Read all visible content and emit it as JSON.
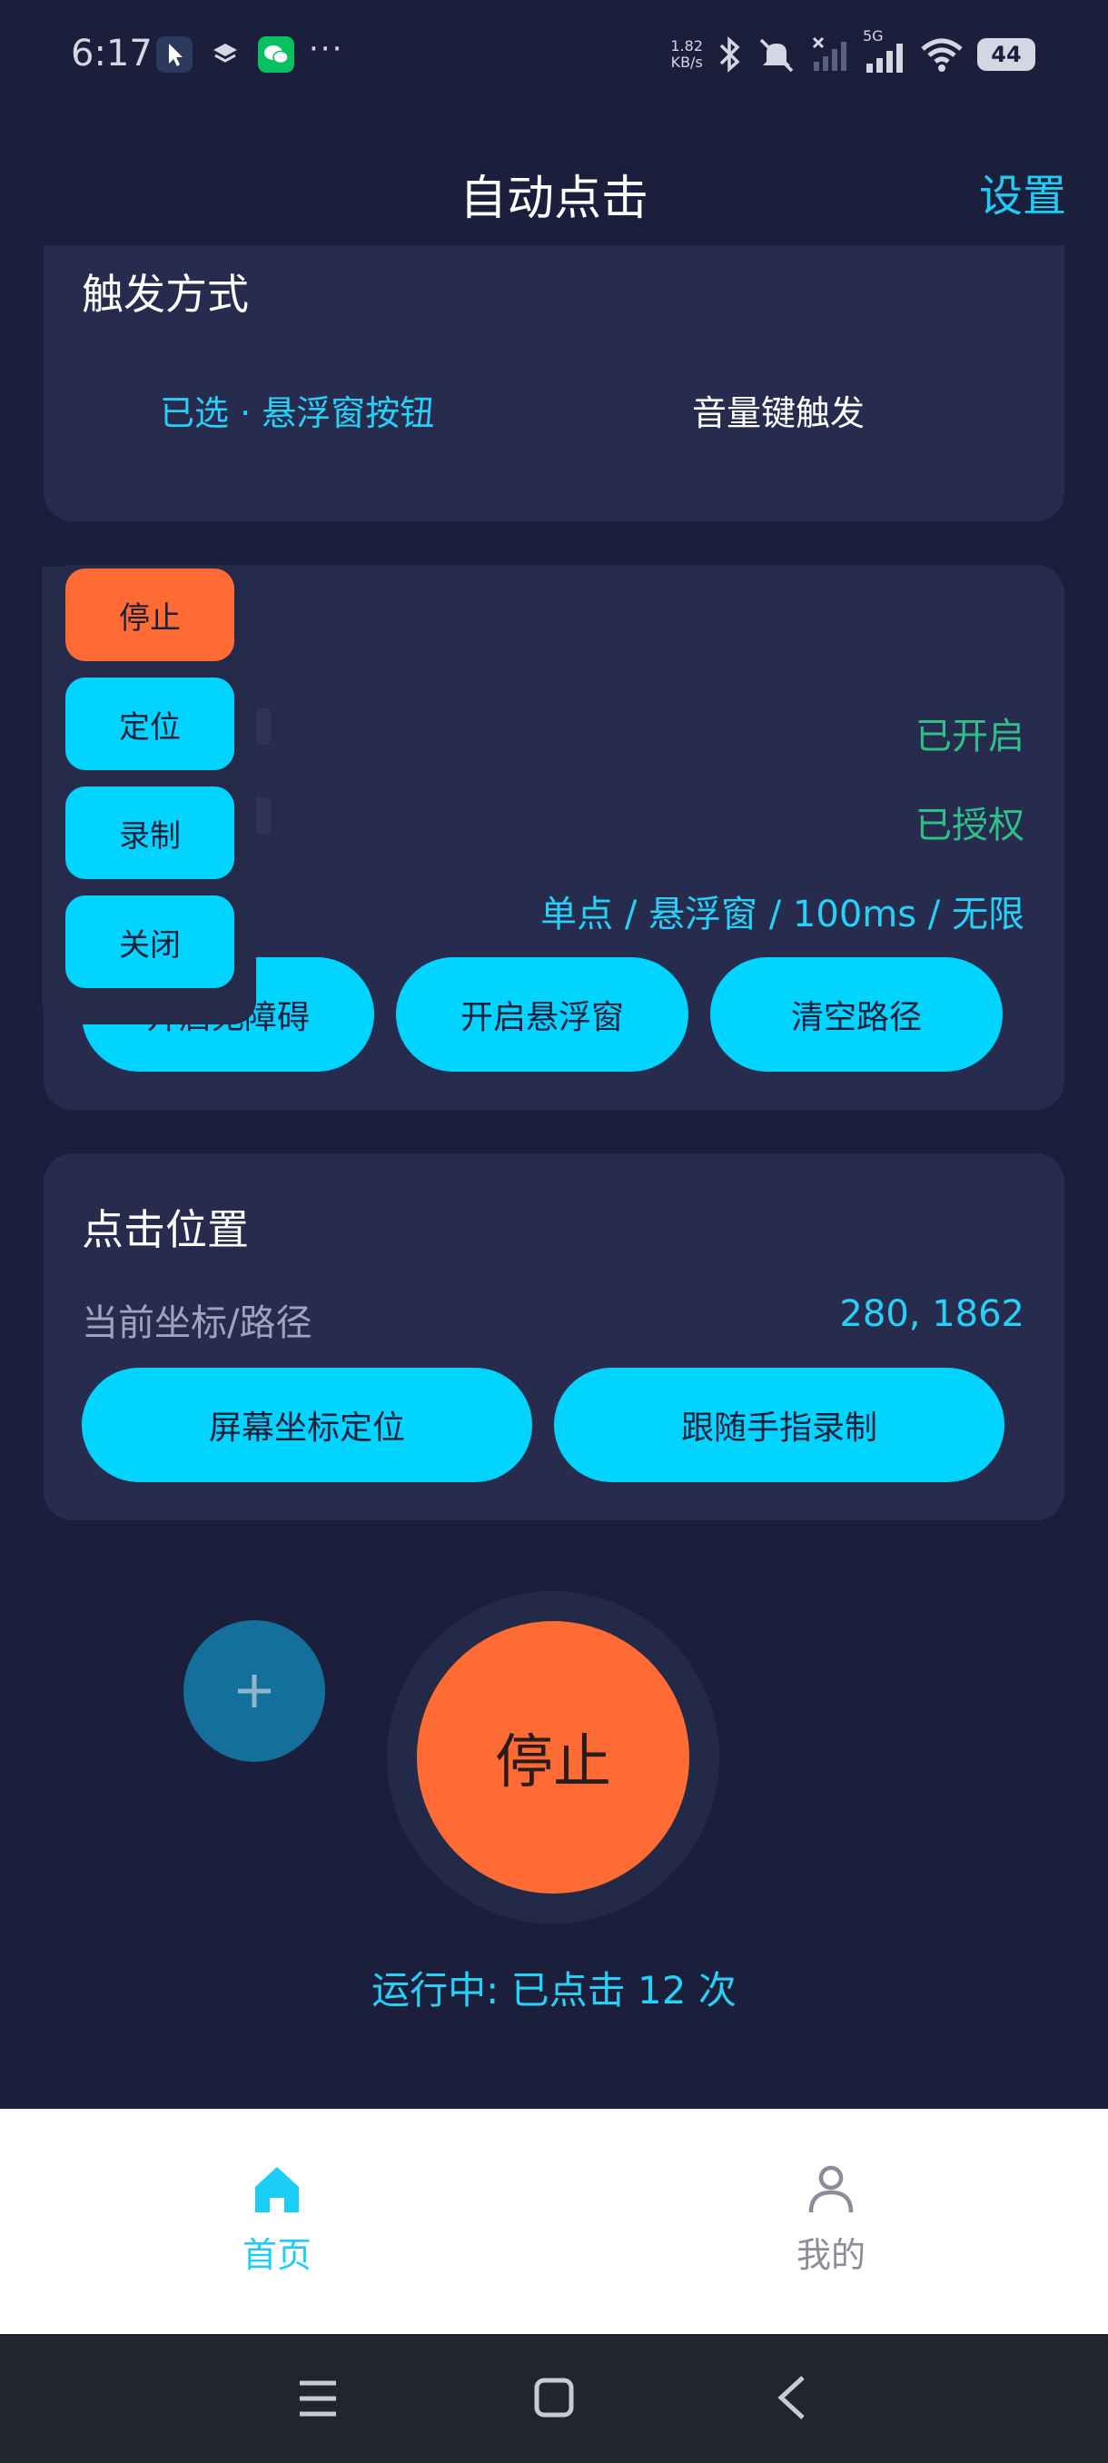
{
  "status_bar": {
    "time": "6:17",
    "more": "···",
    "net_speed_value": "1.82",
    "net_speed_unit": "KB/s",
    "network_type": "5G",
    "battery": "44"
  },
  "header": {
    "title": "自动点击",
    "settings_label": "设置"
  },
  "trigger_card": {
    "title": "触发方式",
    "options": [
      {
        "label": "已选 · 悬浮窗按钮",
        "selected": true
      },
      {
        "label": "音量键触发",
        "selected": false
      }
    ]
  },
  "status_card": {
    "rows": [
      {
        "label": "",
        "value": "已开启"
      },
      {
        "label": "",
        "value": "已授权"
      },
      {
        "label": "",
        "value": "单点 / 悬浮窗 / 100ms / 无限"
      }
    ],
    "buttons": [
      {
        "label": "开启无障碍"
      },
      {
        "label": "开启悬浮窗"
      },
      {
        "label": "清空路径"
      }
    ]
  },
  "floating_menu": {
    "items": [
      {
        "label": "停止",
        "color": "#ff6b35"
      },
      {
        "label": "定位",
        "color": "#00d4ff"
      },
      {
        "label": "录制",
        "color": "#00d4ff"
      },
      {
        "label": "关闭",
        "color": "#00d4ff"
      }
    ]
  },
  "position_card": {
    "title": "点击位置",
    "coord_label": "当前坐标/路径",
    "coord_value": "280, 1862",
    "buttons": [
      {
        "label": "屏幕坐标定位"
      },
      {
        "label": "跟随手指录制"
      }
    ]
  },
  "controls": {
    "add_icon": "plus-icon",
    "stop_label": "停止",
    "running_status": "运行中: 已点击 12 次"
  },
  "bottom_nav": {
    "tabs": [
      {
        "label": "首页",
        "icon": "home-icon",
        "active": true
      },
      {
        "label": "我的",
        "icon": "person-icon",
        "active": false
      }
    ]
  },
  "colors": {
    "background": "#1b1f3b",
    "card": "#272c4e",
    "accent": "#00d4ff",
    "stop": "#ff6b35",
    "enabled_text": "#2fbf8a"
  }
}
